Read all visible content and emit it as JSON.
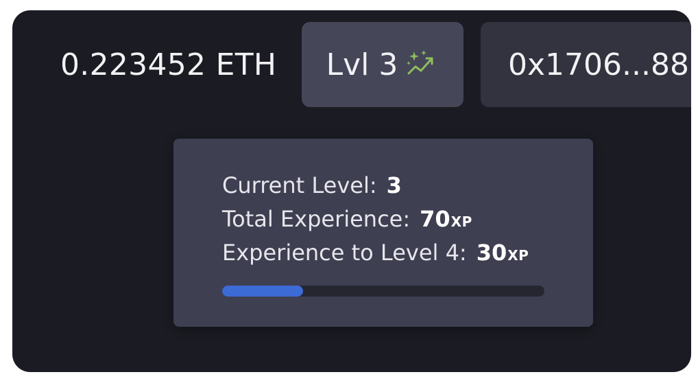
{
  "wallet": {
    "balance": "0.223452 ETH",
    "address_short": "0x1706...88"
  },
  "level_button": {
    "label": "Lvl 3",
    "icon": "sparkle-trend-icon",
    "icon_color": "#8fbf5a"
  },
  "tooltip": {
    "current_level_label": "Current Level:",
    "current_level_value": "3",
    "total_xp_label": "Total Experience:",
    "total_xp_value": "70",
    "xp_to_next_label": "Experience to Level 4:",
    "xp_to_next_value": "30",
    "xp_unit": "XP",
    "progress_fraction": 0.25,
    "progress_color": "#3d6bd6"
  }
}
